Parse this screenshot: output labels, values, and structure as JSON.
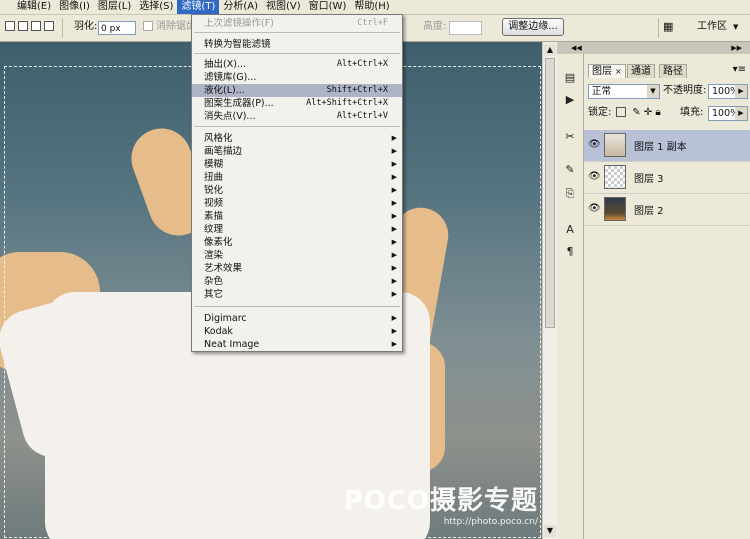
{
  "menubar": {
    "items": [
      "编辑(E)",
      "图像(I)",
      "图层(L)",
      "选择(S)",
      "滤镜(T)",
      "分析(A)",
      "视图(V)",
      "窗口(W)",
      "帮助(H)"
    ],
    "active_index": 4
  },
  "options": {
    "feather_label": "羽化:",
    "feather_value": "0 px",
    "antialias_label": "消除锯齿",
    "height_label": "高度:",
    "refine_edge": "调整边缘...",
    "workspace": "工作区"
  },
  "filter_menu": {
    "last_filter": {
      "label": "上次滤镜操作(F)",
      "shortcut": "Ctrl+F"
    },
    "convert_smart": "转换为智能滤镜",
    "extract": {
      "label": "抽出(X)...",
      "shortcut": "Alt+Ctrl+X"
    },
    "gallery": {
      "label": "滤镜库(G)..."
    },
    "liquify": {
      "label": "液化(L)...",
      "shortcut": "Shift+Ctrl+X"
    },
    "pattern": {
      "label": "图案生成器(P)...",
      "shortcut": "Alt+Shift+Ctrl+X"
    },
    "vanishing": {
      "label": "消失点(V)...",
      "shortcut": "Alt+Ctrl+V"
    },
    "submenus": [
      "风格化",
      "画笔描边",
      "模糊",
      "扭曲",
      "锐化",
      "视频",
      "素描",
      "纹理",
      "像素化",
      "渲染",
      "艺术效果",
      "杂色",
      "其它"
    ],
    "plugins": [
      "Digimarc",
      "Kodak",
      "Neat Image"
    ]
  },
  "layers_panel": {
    "tabs": [
      "图层",
      "通道",
      "路径"
    ],
    "blend_mode": "正常",
    "opacity_label": "不透明度:",
    "opacity_value": "100%",
    "lock_label": "锁定:",
    "fill_label": "填充:",
    "fill_value": "100%",
    "layers": [
      {
        "name": "图层 1 副本",
        "selected": true
      },
      {
        "name": "图层 3",
        "selected": false
      },
      {
        "name": "图层 2",
        "selected": false
      }
    ]
  },
  "watermark": {
    "logo": "POCO摄影专题",
    "url": "http://photo.poco.cn/"
  }
}
